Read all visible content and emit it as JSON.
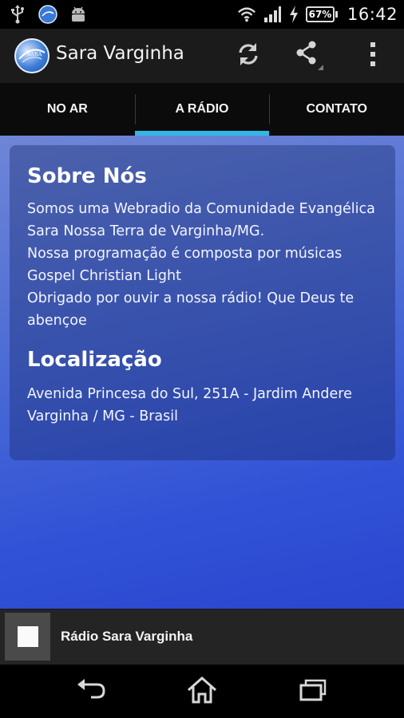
{
  "status_bar": {
    "left_icons": [
      "usb-icon",
      "sara-notification-icon",
      "android-icon"
    ],
    "right_icons": [
      "wifi-icon",
      "signal-icon",
      "charging-icon"
    ],
    "battery": "67%",
    "time": "16:42"
  },
  "action_bar": {
    "logo_text": "SARA",
    "title": "Sara Varginha",
    "actions": [
      "refresh-icon",
      "share-icon",
      "overflow-menu-icon"
    ]
  },
  "tabs": [
    {
      "label": "NO AR",
      "active": false
    },
    {
      "label": "A RÁDIO",
      "active": true
    },
    {
      "label": "CONTATO",
      "active": false
    }
  ],
  "about": {
    "heading": "Sobre Nós",
    "lines": [
      "Somos uma Webradio da Comunidade Evangélica",
      "Sara Nossa Terra de Varginha/MG.",
      "Nossa programação é composta por músicas",
      "Gospel Christian Light",
      "Obrigado por ouvir a nossa rádio! Que Deus te",
      "abençoe"
    ]
  },
  "location": {
    "heading": "Localização",
    "lines": [
      "Avenida Princesa do Sul, 251A - Jardim Andere",
      "Varginha / MG - Brasil"
    ]
  },
  "player": {
    "station": "Rádio Sara Varginha",
    "button": "stop-icon"
  },
  "nav": [
    "back-icon",
    "home-icon",
    "recent-apps-icon"
  ],
  "colors": {
    "tab_indicator": "#33b5e5",
    "content_gradient_start": "#6f86d6",
    "content_gradient_end": "#2a46cf"
  }
}
